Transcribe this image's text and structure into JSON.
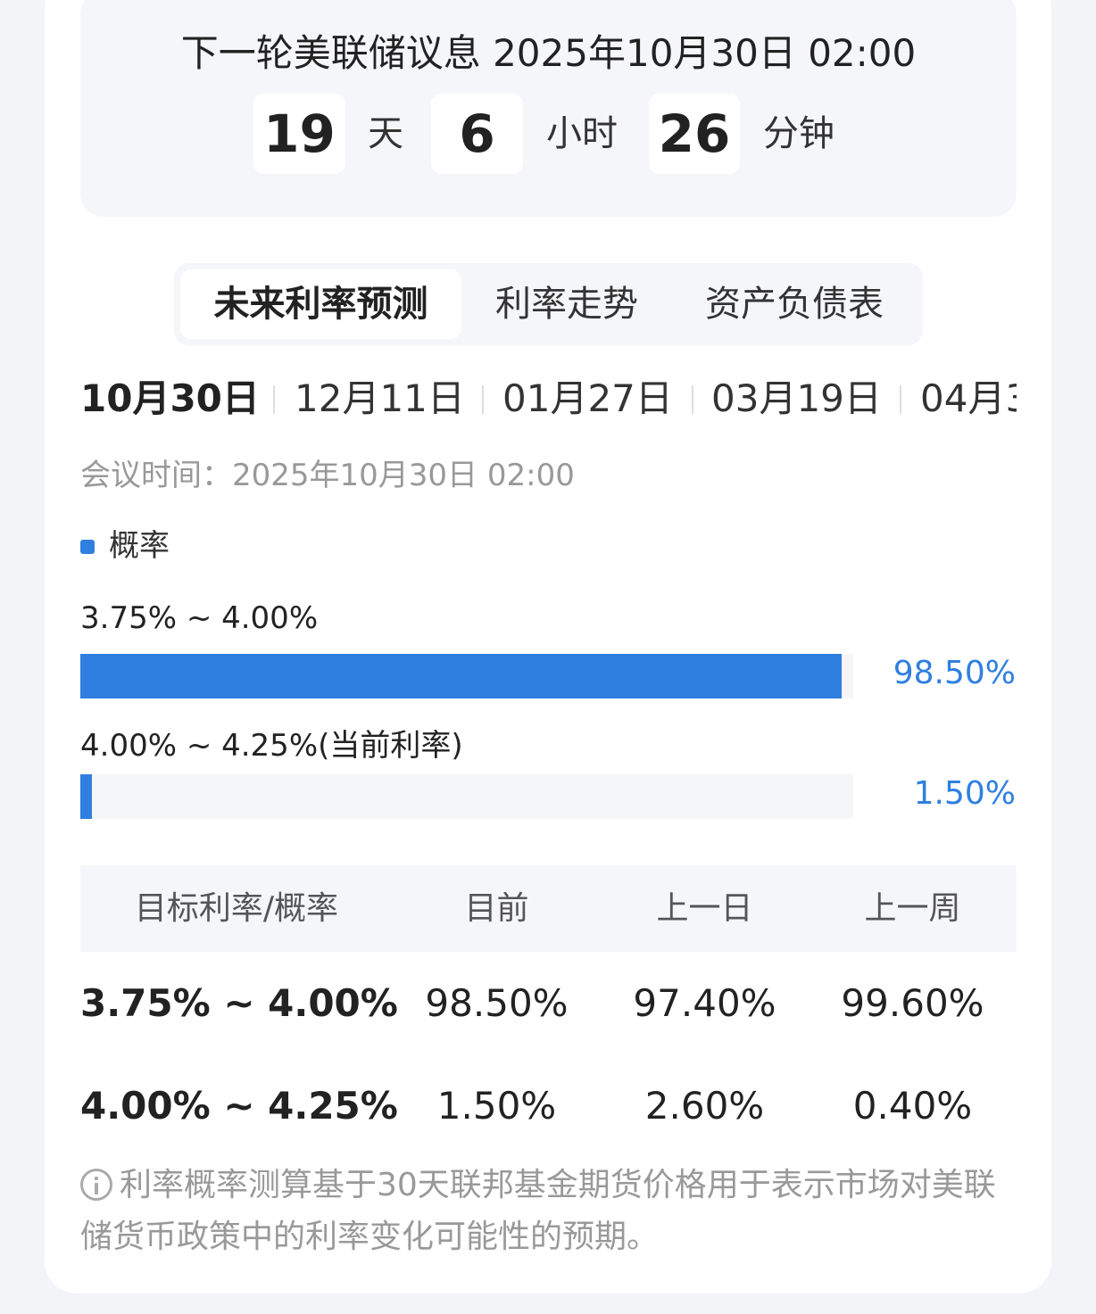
{
  "countdown": {
    "title": "下一轮美联储议息 2025年10月30日 02:00",
    "days": "19",
    "days_unit": "天",
    "hours": "6",
    "hours_unit": "小时",
    "minutes": "26",
    "minutes_unit": "分钟"
  },
  "tabs": [
    {
      "label": "未来利率预测",
      "active": true
    },
    {
      "label": "利率走势",
      "active": false
    },
    {
      "label": "资产负债表",
      "active": false
    }
  ],
  "meeting_dates": [
    {
      "label": "10月30日",
      "active": true
    },
    {
      "label": "12月11日",
      "active": false
    },
    {
      "label": "01月27日",
      "active": false
    },
    {
      "label": "03月19日",
      "active": false
    },
    {
      "label": "04月3",
      "active": false
    }
  ],
  "meeting_time": "会议时间：2025年10月30日 02:00",
  "chart_data": {
    "type": "bar",
    "legend": "概率",
    "categories": [
      "3.75% ~ 4.00%",
      "4.00% ~ 4.25%(当前利率)"
    ],
    "values": [
      98.5,
      1.5
    ],
    "value_labels": [
      "98.50%",
      "1.50%"
    ],
    "xlim": [
      0,
      100
    ],
    "color": "#2f7fe0"
  },
  "table": {
    "headers": [
      "目标利率/概率",
      "目前",
      "上一日",
      "上一周"
    ],
    "rows": [
      [
        "3.75% ~ 4.00%",
        "98.50%",
        "97.40%",
        "99.60%"
      ],
      [
        "4.00% ~ 4.25%",
        "1.50%",
        "2.60%",
        "0.40%"
      ]
    ]
  },
  "note": {
    "icon": "info-icon",
    "text": "利率概率测算基于30天联邦基金期货价格用于表示市场对美联储货币政策中的利率变化可能性的预期。"
  }
}
